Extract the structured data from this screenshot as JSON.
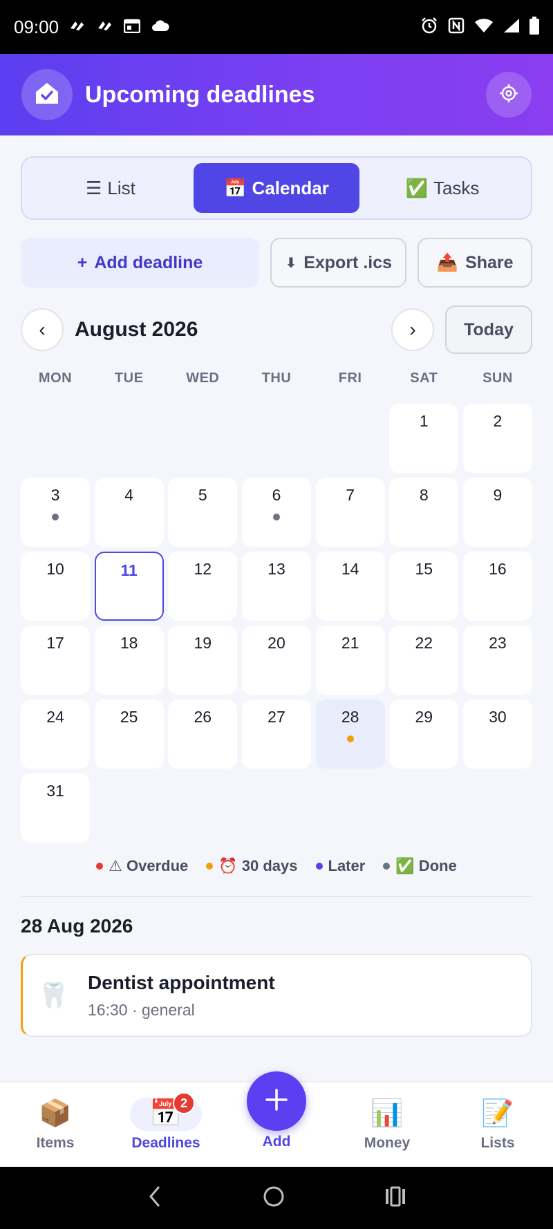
{
  "status_bar": {
    "time": "09:00",
    "left_icons": [
      "notification-icon",
      "notification-icon",
      "calendar-icon",
      "cloud-icon"
    ],
    "right_icons": [
      "alarm-icon",
      "nfc-icon",
      "wifi-icon",
      "signal-icon",
      "battery-icon"
    ]
  },
  "header": {
    "title": "Upcoming deadlines",
    "gradient": [
      "#5b3ff0",
      "#8a3ef0"
    ]
  },
  "tabs": [
    {
      "icon": "☰",
      "label": "List",
      "active": false
    },
    {
      "icon": "📅",
      "label": "Calendar",
      "active": true
    },
    {
      "icon": "✅",
      "label": "Tasks",
      "active": false
    }
  ],
  "actions": {
    "add": {
      "icon": "+",
      "label": "Add deadline"
    },
    "export": {
      "icon": "⬇",
      "label": "Export .ics"
    },
    "share": {
      "icon": "📤",
      "label": "Share"
    }
  },
  "month_nav": {
    "prev": "‹",
    "next": "›",
    "month": "August 2026",
    "today": "Today"
  },
  "weekdays": [
    "MON",
    "TUE",
    "WED",
    "THU",
    "FRI",
    "SAT",
    "SUN"
  ],
  "calendar": {
    "leading_empty": 5,
    "days": 31,
    "today": 11,
    "selected": 28,
    "markers": {
      "3": "done",
      "6": "done",
      "28": "soon"
    }
  },
  "legend": [
    {
      "key": "overdue",
      "label": "⚠ Overdue",
      "color": "#e53935"
    },
    {
      "key": "soon",
      "label": "⏰ 30 days",
      "color": "#f59e0b"
    },
    {
      "key": "later",
      "label": "Later",
      "color": "#4f46e5"
    },
    {
      "key": "done",
      "label": "✅ Done",
      "color": "#6b7280"
    }
  ],
  "selected_day": {
    "heading": "28 Aug 2026",
    "events": [
      {
        "icon": "🦷",
        "title": "Dentist appointment",
        "subtitle": "16:30 · general"
      }
    ]
  },
  "bottom_nav": {
    "items": [
      {
        "icon": "📦",
        "label": "Items",
        "active": false
      },
      {
        "icon": "📅",
        "label": "Deadlines",
        "active": true,
        "badge": "2"
      },
      {
        "icon": "📊",
        "label": "Money",
        "active": false
      },
      {
        "icon": "📝",
        "label": "Lists",
        "active": false
      }
    ],
    "fab": {
      "icon": "+",
      "label": "Add"
    }
  },
  "colors": {
    "accent": "#4f46e5",
    "soon": "#f59e0b",
    "done": "#6b7280",
    "overdue": "#e53935"
  }
}
